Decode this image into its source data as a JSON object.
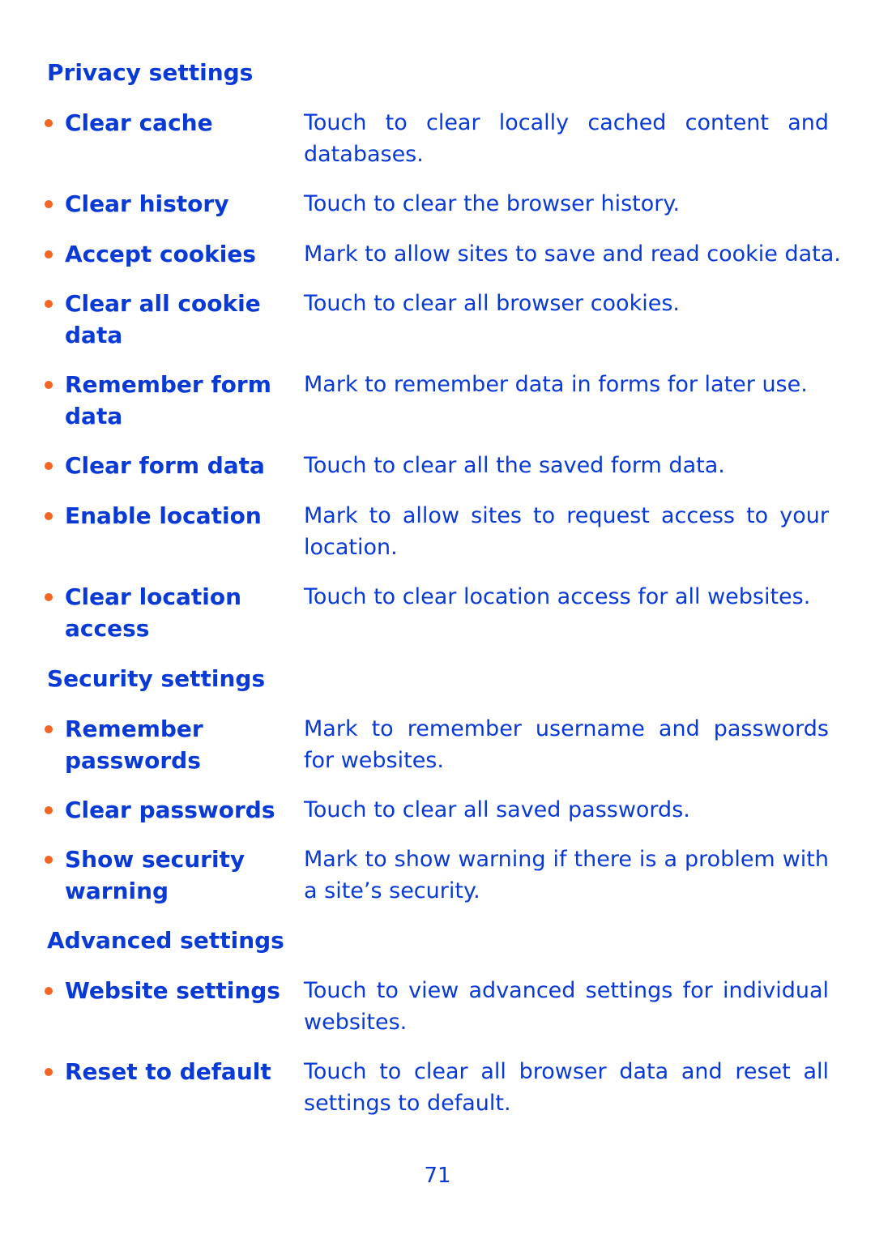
{
  "colors": {
    "text": "#0a3ad6",
    "bullet": "#f26522",
    "background": "#ffffff"
  },
  "sections": [
    {
      "heading": "Privacy settings",
      "items": [
        {
          "term": "Clear cache",
          "desc": "Touch to clear locally cached content and databases."
        },
        {
          "term": "Clear history",
          "desc": "Touch to clear the browser history."
        },
        {
          "term": "Accept cookies",
          "desc": "Mark to allow sites to save and read cookie data."
        },
        {
          "term": "Clear all cookie data",
          "desc": "Touch to clear all browser cookies."
        },
        {
          "term": "Remember form data",
          "desc": "Mark to remember data in forms for later use."
        },
        {
          "term": "Clear form data",
          "desc": "Touch to clear all the saved form data."
        },
        {
          "term": "Enable location",
          "desc": "Mark to allow sites to request access to your location."
        },
        {
          "term": "Clear location access",
          "desc": "Touch to clear location access for all websites."
        }
      ]
    },
    {
      "heading": "Security settings",
      "items": [
        {
          "term": "Remember passwords",
          "desc": "Mark to remember username and passwords for websites."
        },
        {
          "term": "Clear passwords",
          "desc": "Touch to clear all saved passwords."
        },
        {
          "term": "Show security warning",
          "desc": "Mark to show warning if there is a problem with a site’s security."
        }
      ]
    },
    {
      "heading": "Advanced settings",
      "items": [
        {
          "term": "Website settings",
          "desc": "Touch to view advanced settings for individual websites."
        },
        {
          "term": "Reset to default",
          "desc": "Touch to clear all browser data and reset all settings to default."
        }
      ]
    }
  ],
  "page_number": "71"
}
